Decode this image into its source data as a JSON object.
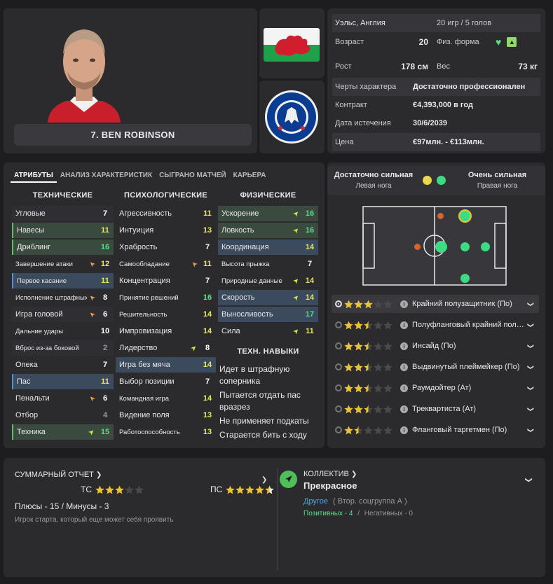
{
  "player": {
    "name": "7. BEN ROBINSON"
  },
  "info": {
    "nation": "Уэльс, Англия",
    "caps": "20 игр / 5 голов",
    "age_label": "Возраст",
    "age": "20",
    "fitness_label": "Физ. форма",
    "height_label": "Рост",
    "height": "178 см",
    "weight_label": "Вес",
    "weight": "73 кг",
    "personality_label": "Черты характера",
    "personality": "Достаточно профессионален",
    "contract_label": "Контракт",
    "contract": "€4,393,000 в год",
    "expiry_label": "Дата истечения",
    "expiry": "30/6/2039",
    "value_label": "Цена",
    "value": "€97млн. - €113млн."
  },
  "club_crest_text": "CHELSEA FOOTBALL CLUB",
  "tabs": [
    "АТРИБУТЫ",
    "АНАЛИЗ ХАРАКТЕРИСТИК",
    "СЫГРАНО МАТЧЕЙ",
    "КАРЬЕРА"
  ],
  "columns": {
    "technical": "ТЕХНИЧЕСКИЕ",
    "mental": "ПСИХОЛОГИЧЕСКИЕ",
    "physical": "ФИЗИЧЕСКИЕ"
  },
  "technical": [
    {
      "label": "Угловые",
      "value": "7",
      "arrow": ""
    },
    {
      "label": "Навесы",
      "value": "11",
      "arrow": ""
    },
    {
      "label": "Дриблинг",
      "value": "16",
      "arrow": ""
    },
    {
      "label": "Завершение атаки",
      "value": "12",
      "arrow": "down"
    },
    {
      "label": "Первое касание",
      "value": "11",
      "arrow": ""
    },
    {
      "label": "Исполнение штрафных",
      "value": "8",
      "arrow": "down"
    },
    {
      "label": "Игра головой",
      "value": "6",
      "arrow": "down"
    },
    {
      "label": "Дальние удары",
      "value": "10",
      "arrow": ""
    },
    {
      "label": "Вброс из-за боковой",
      "value": "2",
      "arrow": ""
    },
    {
      "label": "Опека",
      "value": "7",
      "arrow": ""
    },
    {
      "label": "Пас",
      "value": "11",
      "arrow": ""
    },
    {
      "label": "Пенальти",
      "value": "6",
      "arrow": "down"
    },
    {
      "label": "Отбор",
      "value": "4",
      "arrow": ""
    },
    {
      "label": "Техника",
      "value": "15",
      "arrow": "up"
    }
  ],
  "mental": [
    {
      "label": "Агрессивность",
      "value": "11",
      "arrow": ""
    },
    {
      "label": "Интуиция",
      "value": "13",
      "arrow": ""
    },
    {
      "label": "Храбрость",
      "value": "7",
      "arrow": ""
    },
    {
      "label": "Самообладание",
      "value": "11",
      "arrow": "down"
    },
    {
      "label": "Концентрация",
      "value": "7",
      "arrow": ""
    },
    {
      "label": "Принятие решений",
      "value": "16",
      "arrow": ""
    },
    {
      "label": "Решительность",
      "value": "14",
      "arrow": ""
    },
    {
      "label": "Импровизация",
      "value": "14",
      "arrow": ""
    },
    {
      "label": "Лидерство",
      "value": "8",
      "arrow": "up"
    },
    {
      "label": "Игра без мяча",
      "value": "14",
      "arrow": ""
    },
    {
      "label": "Выбор позиции",
      "value": "7",
      "arrow": ""
    },
    {
      "label": "Командная игра",
      "value": "14",
      "arrow": ""
    },
    {
      "label": "Видение поля",
      "value": "13",
      "arrow": ""
    },
    {
      "label": "Работоспособность",
      "value": "13",
      "arrow": ""
    }
  ],
  "physical": [
    {
      "label": "Ускорение",
      "value": "16",
      "arrow": "up"
    },
    {
      "label": "Ловкость",
      "value": "16",
      "arrow": "up"
    },
    {
      "label": "Координация",
      "value": "14",
      "arrow": ""
    },
    {
      "label": "Высота прыжка",
      "value": "7",
      "arrow": ""
    },
    {
      "label": "Природные данные",
      "value": "14",
      "arrow": "up"
    },
    {
      "label": "Скорость",
      "value": "14",
      "arrow": "up"
    },
    {
      "label": "Выносливость",
      "value": "17",
      "arrow": ""
    },
    {
      "label": "Сила",
      "value": "11",
      "arrow": "up"
    }
  ],
  "tech_skills": {
    "title": "ТЕХН. НАВЫКИ",
    "items": [
      "Идет в штрафную соперника",
      "Пытается отдать пас вразрез",
      "Не применяет подкаты",
      "Старается бить с ходу"
    ]
  },
  "feet": {
    "left_strength": "Достаточно сильная",
    "left_label": "Левая нога",
    "left_color": "#e8d84a",
    "right_strength": "Очень сильная",
    "right_label": "Правая нога",
    "right_color": "#3ddc84"
  },
  "roles": [
    {
      "name": "Крайний полузащитник (По)",
      "stars": 3,
      "selected": true
    },
    {
      "name": "Полуфланговый крайний полу…",
      "stars": 2.5,
      "selected": false
    },
    {
      "name": "Инсайд (По)",
      "stars": 2.5,
      "selected": false
    },
    {
      "name": "Выдвинутый плеймейкер (По)",
      "stars": 2.5,
      "selected": false
    },
    {
      "name": "Раумдойтер (Ат)",
      "stars": 2.5,
      "selected": false
    },
    {
      "name": "Треквартиста (Ат)",
      "stars": 2.5,
      "selected": false
    },
    {
      "name": "Фланговый таргетмен (По)",
      "stars": 1.5,
      "selected": false
    }
  ],
  "report": {
    "title": "СУММАРНЫЙ ОТЧЕТ",
    "tc_label": "ТС",
    "tc_stars": 3,
    "pc_label": "ПС",
    "pc_stars": 4.5,
    "pros_cons": "Плюсы - 15 / Минусы - 3",
    "summary": "Игрок старта, который еще может себя проявить"
  },
  "collective": {
    "title": "КОЛЛЕКТИВ",
    "status": "Прекрасное",
    "group": "Другое",
    "subgroup": "( Втор. соцгруппа А )",
    "positive": "Позитивных - 4",
    "separator": "/",
    "negative": "Негативных - 0"
  },
  "colors": {
    "accent_green": "#55e088",
    "accent_yellow": "#e8e85c",
    "highlight_blue": "#3b4a5c",
    "highlight_green": "#3a4a3e"
  }
}
